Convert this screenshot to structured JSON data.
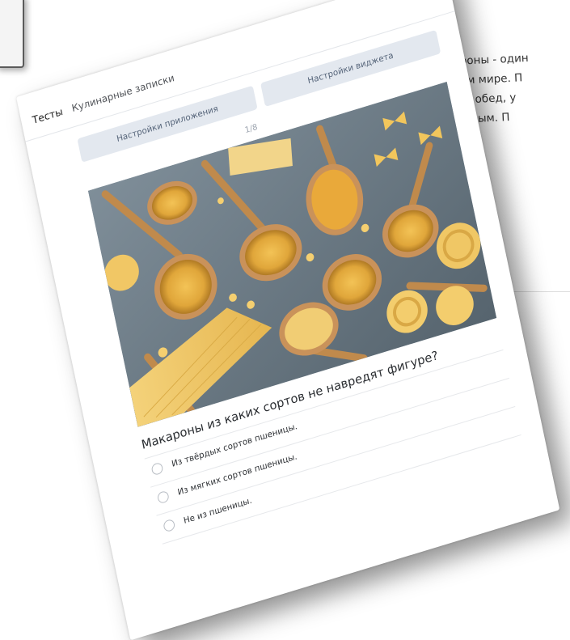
{
  "background_article": {
    "lines": [
      "ароны - один",
      "сём мире. П",
      "ак, обед, у",
      "бимым. П"
    ]
  },
  "popup": {
    "close_glyph": "×",
    "tabs": [
      {
        "label": "Тесты",
        "active": true
      },
      {
        "label": "Кулинарные записки",
        "active": false
      }
    ],
    "buttons": {
      "app_settings": "Настройки приложения",
      "widget_settings": "Настройки виджета"
    },
    "progress": "1/8",
    "image_alt": "pasta varieties on wooden spoons",
    "question": "Макароны из каких сортов не навредят фигуре?",
    "answers": [
      "Из твёрдых сортов пшеницы.",
      "Из мягких сортов пшеницы.",
      "Не из пшеницы."
    ]
  },
  "colors": {
    "button_bg": "#e3e8ef",
    "button_text": "#56657a",
    "divider": "#e6e8eb",
    "photo_bg": "#6d7c88"
  }
}
